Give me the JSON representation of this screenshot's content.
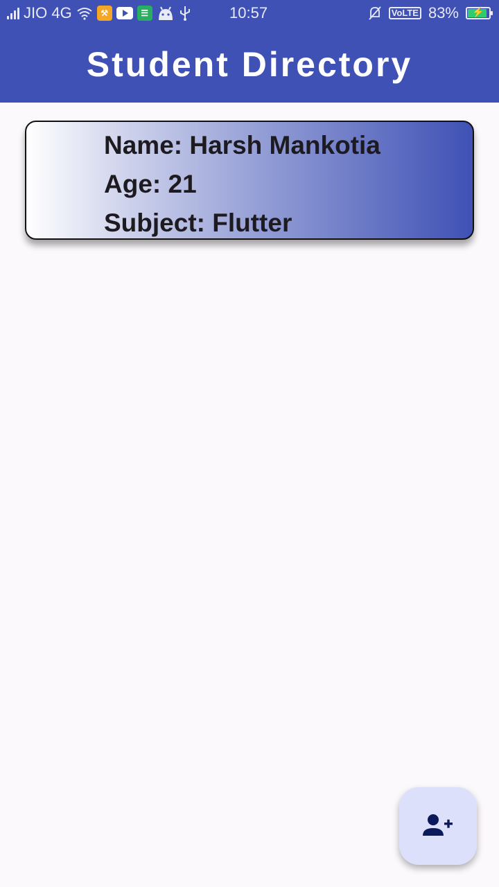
{
  "status_bar": {
    "carrier": "JIO 4G",
    "time": "10:57",
    "volte": "VoLTE",
    "battery": "83%",
    "battery_level": 0.83,
    "icons": [
      "signal-icon",
      "wifi-icon",
      "app-notification-icon",
      "youtube-icon",
      "shop-icon",
      "android-icon",
      "usb-icon",
      "mute-icon",
      "battery-icon"
    ]
  },
  "app_bar": {
    "title": "Student Directory"
  },
  "students": [
    {
      "name_line": "Name: Harsh Mankotia",
      "age_line": "Age: 21",
      "subject_line": "Subject: Flutter"
    }
  ],
  "fab": {
    "icon": "person-add-icon"
  },
  "colors": {
    "primary": "#3f51b5",
    "background": "#fcf9fd",
    "fab_bg": "#dde0fa",
    "fab_icon": "#0b1a5b",
    "battery": "#2ecc71"
  }
}
